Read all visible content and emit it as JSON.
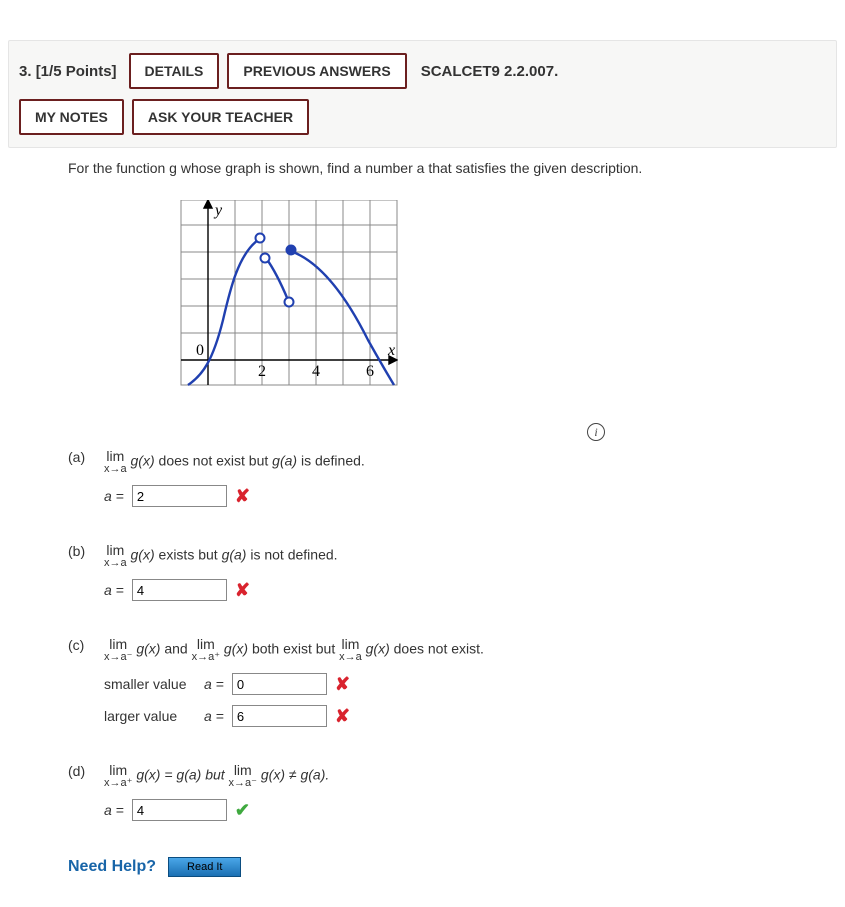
{
  "header": {
    "qnum": "3.",
    "points": "[1/5 Points]",
    "details": "DETAILS",
    "prev": "PREVIOUS ANSWERS",
    "source": "SCALCET9 2.2.007.",
    "notes": "MY NOTES",
    "ask": "ASK YOUR TEACHER"
  },
  "prompt": "For the function g whose graph is shown, find a number a that satisfies the given description.",
  "graph": {
    "ylabel": "y",
    "xlabel": "x",
    "origin": "0",
    "ticks": [
      "2",
      "4",
      "6"
    ]
  },
  "parts": {
    "a": {
      "label": "(a)",
      "text_after": " does not exist but ",
      "ga": "g(a)",
      "text_after2": " is defined.",
      "value": "2",
      "status": "wrong"
    },
    "b": {
      "label": "(b)",
      "text_mid": " exists but ",
      "ga": "g(a)",
      "text_after": " is not defined.",
      "value": "4",
      "status": "wrong"
    },
    "c": {
      "label": "(c)",
      "text_and": " and ",
      "text_both": " both exist but ",
      "text_end": " does not exist.",
      "smaller_label": "smaller value",
      "larger_label": "larger value",
      "smaller_value": "0",
      "larger_value": "6",
      "smaller_status": "wrong",
      "larger_status": "wrong"
    },
    "d": {
      "label": "(d)",
      "eq_ga": " = g(a) but ",
      "neq_ga": " ≠ g(a).",
      "value": "4",
      "status": "right"
    }
  },
  "common": {
    "a_eq": "a = ",
    "lim": "lim",
    "xa": "x→a",
    "xa_minus": "x→a⁻",
    "xa_plus": "x→a⁺",
    "gx": "g(x)"
  },
  "help": {
    "label": "Need Help?",
    "read": "Read It"
  },
  "info_icon": "i"
}
